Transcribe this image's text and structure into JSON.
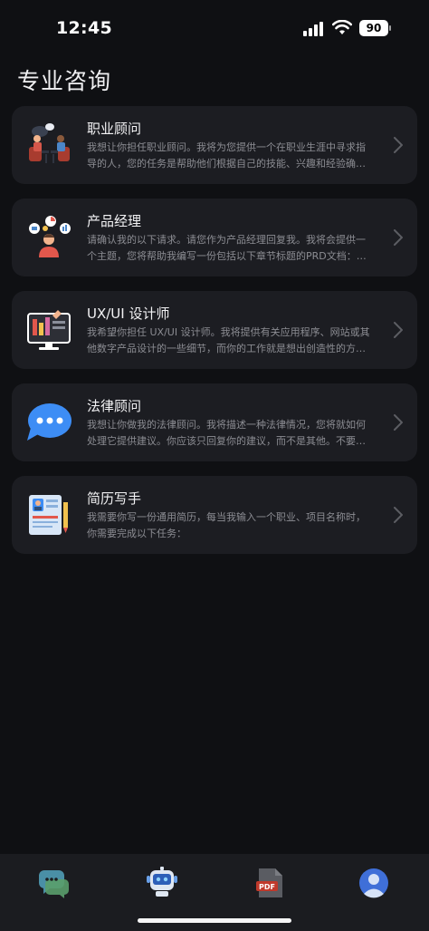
{
  "status_bar": {
    "time": "12:45",
    "battery": "90"
  },
  "page": {
    "title": "专业咨询"
  },
  "items": [
    {
      "title": "职业顾问",
      "desc": "我想让你担任职业顾问。我将为您提供一个在职业生涯中寻求指导的人，您的任务是帮助他们根据自己的技能、兴趣和经验确…",
      "icon": "career-advisor-icon"
    },
    {
      "title": "产品经理",
      "desc": "请确认我的以下请求。请您作为产品经理回复我。我将会提供一个主题，您将帮助我编写一份包括以下章节标题的PRD文档：…",
      "icon": "product-manager-icon"
    },
    {
      "title": "UX/UI 设计师",
      "desc": "我希望你担任 UX/UI 设计师。我将提供有关应用程序、网站或其他数字产品设计的一些细节，而你的工作就是想出创造性的方…",
      "icon": "design-monitor-icon"
    },
    {
      "title": "法律顾问",
      "desc": "我想让你做我的法律顾问。我将描述一种法律情况，您将就如何处理它提供建议。你应该只回复你的建议，而不是其他。不要…",
      "icon": "chat-bubble-icon"
    },
    {
      "title": "简历写手",
      "desc": "我需要你写一份通用简历，每当我输入一个职业、项目名称时，你需要完成以下任务：",
      "icon": "resume-icon"
    }
  ],
  "tabbar": {
    "tabs": [
      {
        "name": "chat-tab",
        "icon": "chat-icon"
      },
      {
        "name": "robot-tab",
        "icon": "robot-icon"
      },
      {
        "name": "pdf-tab",
        "icon": "pdf-icon"
      },
      {
        "name": "profile-tab",
        "icon": "profile-icon"
      }
    ]
  },
  "colors": {
    "background": "#0f1013",
    "card": "#1c1d22",
    "accent_blue": "#3d8df5"
  }
}
